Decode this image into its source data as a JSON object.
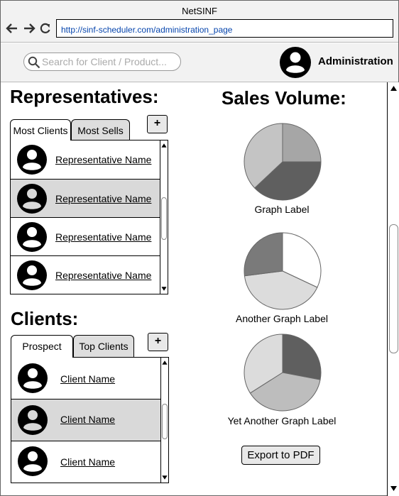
{
  "window": {
    "title": "NetSINF"
  },
  "browser": {
    "url": "http://sinf-scheduler.com/administration_page"
  },
  "header": {
    "search_placeholder": "Search for Client / Product...",
    "user_label": "Administration"
  },
  "representatives": {
    "heading": "Representatives:",
    "tabs": [
      {
        "label": "Most Clients",
        "active": true
      },
      {
        "label": "Most Sells",
        "active": false
      }
    ],
    "add_label": "+",
    "items": [
      {
        "name": "Representative Name",
        "selected": false
      },
      {
        "name": "Representative Name",
        "selected": true
      },
      {
        "name": "Representative Name",
        "selected": false
      },
      {
        "name": "Representative Name",
        "selected": false
      }
    ]
  },
  "clients": {
    "heading": "Clients:",
    "tabs": [
      {
        "label": "Prospect",
        "active": true
      },
      {
        "label": "Top Clients",
        "active": false
      }
    ],
    "add_label": "+",
    "items": [
      {
        "name": "Client Name",
        "selected": false
      },
      {
        "name": "Client Name",
        "selected": true
      },
      {
        "name": "Client Name",
        "selected": false
      }
    ]
  },
  "sales": {
    "heading": "Sales Volume:",
    "export_label": "Export to PDF"
  },
  "chart_data": [
    {
      "type": "pie",
      "title": "Graph Label",
      "values": [
        25,
        38,
        37
      ],
      "colors": [
        "#a6a6a6",
        "#5f5f5f",
        "#c4c4c4"
      ]
    },
    {
      "type": "pie",
      "title": "Another Graph Label",
      "values": [
        32,
        41,
        27
      ],
      "colors": [
        "#ffffff",
        "#dcdcdc",
        "#7a7a7a"
      ]
    },
    {
      "type": "pie",
      "title": "Yet Another Graph Label",
      "values": [
        28,
        38,
        34
      ],
      "colors": [
        "#5f5f5f",
        "#bdbdbd",
        "#dcdcdc"
      ]
    }
  ]
}
